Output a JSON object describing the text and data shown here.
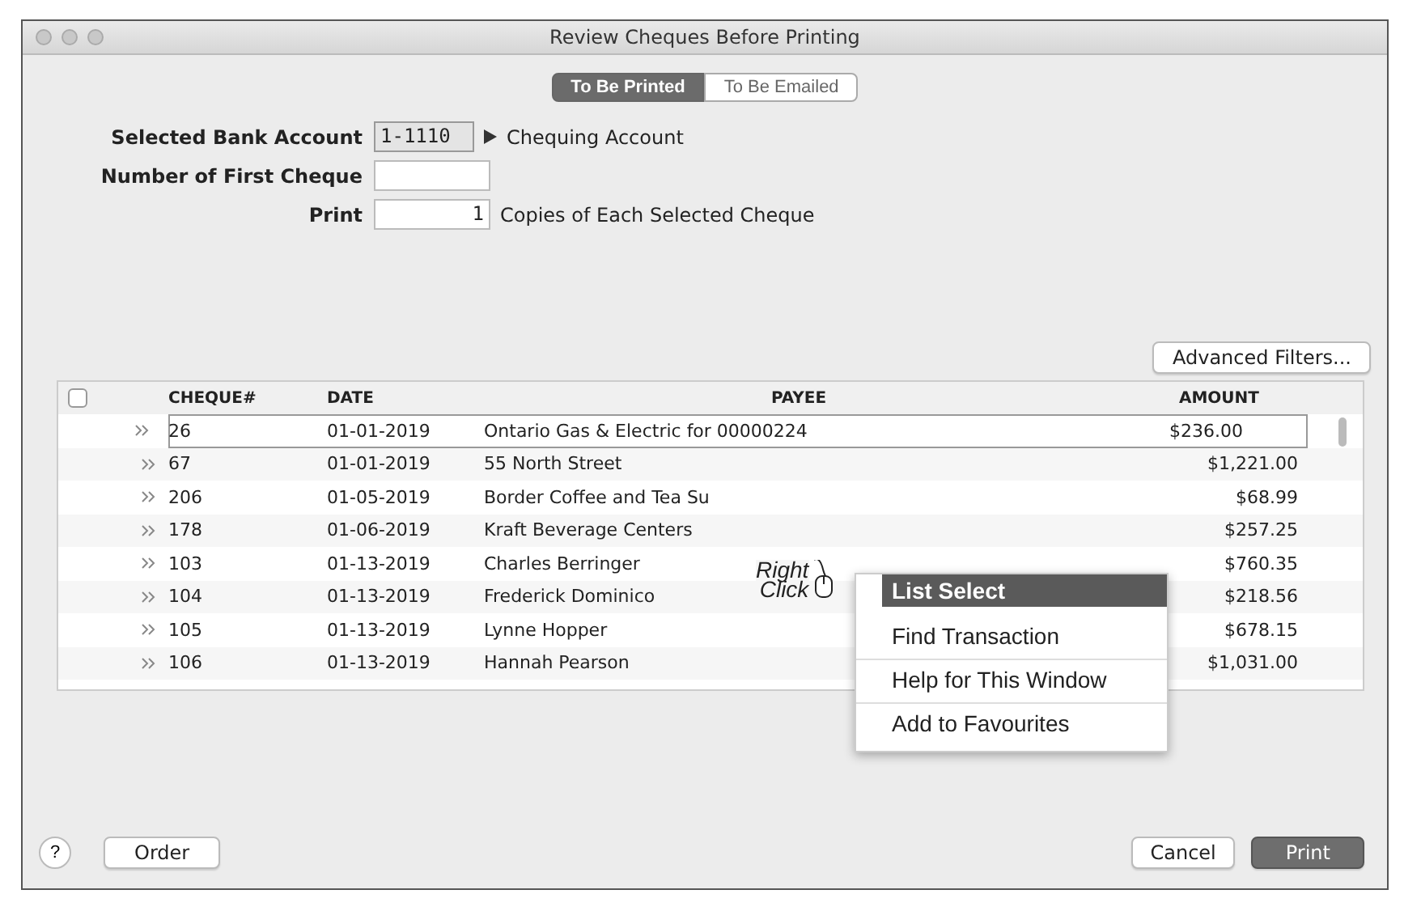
{
  "window": {
    "title": "Review Cheques Before Printing"
  },
  "tabs": [
    {
      "label": "To Be Printed",
      "selected": true
    },
    {
      "label": "To Be Emailed",
      "selected": false
    }
  ],
  "form": {
    "bank_account_label": "Selected Bank Account",
    "bank_account_value": "1-1110",
    "bank_account_name": "Chequing Account",
    "first_cheque_label": "Number of First Cheque",
    "print_label": "Print",
    "copies_value": "1",
    "copies_suffix": "Copies of Each Selected Cheque"
  },
  "advanced_filters_button": "Advanced Filters...",
  "table": {
    "select_all_checked": false,
    "columns": [
      "CHEQUE#",
      "DATE",
      "PAYEE",
      "AMOUNT"
    ],
    "rows": [
      {
        "cheque": "26",
        "date": "01-01-2019",
        "payee": "Ontario Gas & Electric for 00000224",
        "amount": "$236.00",
        "selected": true
      },
      {
        "cheque": "67",
        "date": "01-01-2019",
        "payee": "55 North Street",
        "amount": "$1,221.00",
        "selected": false
      },
      {
        "cheque": "206",
        "date": "01-05-2019",
        "payee": "Border Coffee and Tea Su",
        "amount": "$68.99",
        "selected": false
      },
      {
        "cheque": "178",
        "date": "01-06-2019",
        "payee": "Kraft Beverage Centers",
        "amount": "$257.25",
        "selected": false
      },
      {
        "cheque": "103",
        "date": "01-13-2019",
        "payee": "Charles Berringer",
        "amount": "$760.35",
        "selected": false
      },
      {
        "cheque": "104",
        "date": "01-13-2019",
        "payee": "Frederick Dominico",
        "amount": "$218.56",
        "selected": false
      },
      {
        "cheque": "105",
        "date": "01-13-2019",
        "payee": "Lynne Hopper",
        "amount": "$678.15",
        "selected": false
      },
      {
        "cheque": "106",
        "date": "01-13-2019",
        "payee": "Hannah Pearson",
        "amount": "$1,031.00",
        "selected": false
      }
    ]
  },
  "annotation": {
    "line_1": "Right",
    "line_2": "Click"
  },
  "context_menu": [
    {
      "label": "List Select",
      "selected": true
    },
    {
      "label": "Find Transaction",
      "selected": false
    },
    {
      "label": "Help for This Window",
      "selected": false
    },
    {
      "label": "Add to Favourites",
      "selected": false
    }
  ],
  "footer": {
    "help_button": "?",
    "order_button": "Order",
    "cancel_button": "Cancel",
    "print_button": "Print"
  }
}
